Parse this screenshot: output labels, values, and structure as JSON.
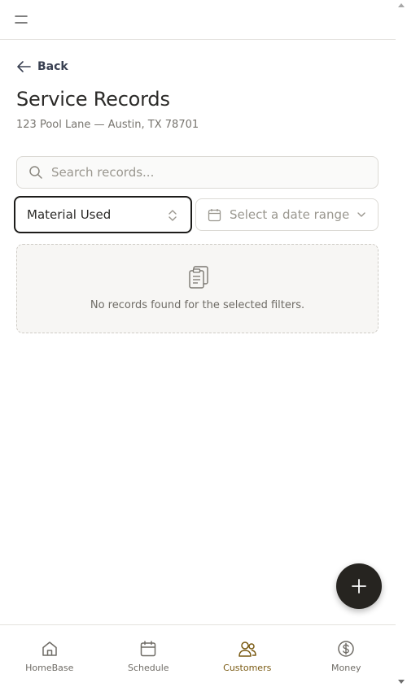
{
  "header": {
    "menu_icon": "menu-icon"
  },
  "back": {
    "label": "Back",
    "icon": "arrow-left-icon"
  },
  "page": {
    "title": "Service Records",
    "subtitle": "123 Pool Lane — Austin, TX 78701"
  },
  "search": {
    "placeholder": "Search records...",
    "value": ""
  },
  "filters": {
    "type": {
      "selected": "Material Used"
    },
    "date": {
      "placeholder": "Select a date range"
    }
  },
  "empty_state": {
    "icon": "clipboard-icon",
    "message": "No records found for the selected filters."
  },
  "fab": {
    "icon": "plus-icon"
  },
  "nav": {
    "items": [
      {
        "label": "HomeBase",
        "icon": "home-icon",
        "active": false
      },
      {
        "label": "Schedule",
        "icon": "calendar-icon",
        "active": false
      },
      {
        "label": "Customers",
        "icon": "users-icon",
        "active": true
      },
      {
        "label": "Money",
        "icon": "dollar-icon",
        "active": false
      }
    ]
  },
  "colors": {
    "accent": "#7a5a12",
    "fab": "#262420",
    "border": "#dcdad5",
    "text": "#2b2a28"
  }
}
